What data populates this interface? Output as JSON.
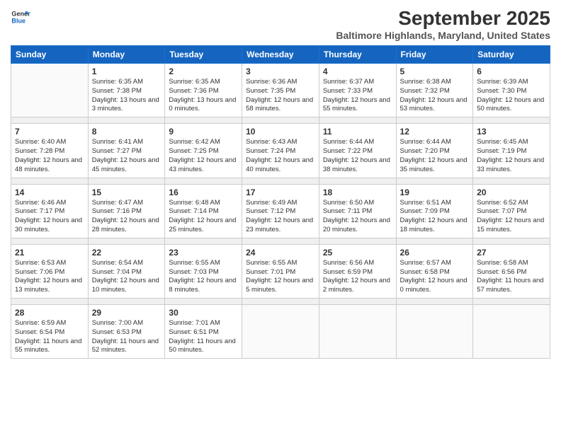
{
  "header": {
    "logo_line1": "General",
    "logo_line2": "Blue",
    "title": "September 2025",
    "subtitle": "Baltimore Highlands, Maryland, United States"
  },
  "days_of_week": [
    "Sunday",
    "Monday",
    "Tuesday",
    "Wednesday",
    "Thursday",
    "Friday",
    "Saturday"
  ],
  "weeks": [
    [
      {
        "day": "",
        "sunrise": "",
        "sunset": "",
        "daylight": ""
      },
      {
        "day": "1",
        "sunrise": "Sunrise: 6:35 AM",
        "sunset": "Sunset: 7:38 PM",
        "daylight": "Daylight: 13 hours and 3 minutes."
      },
      {
        "day": "2",
        "sunrise": "Sunrise: 6:35 AM",
        "sunset": "Sunset: 7:36 PM",
        "daylight": "Daylight: 13 hours and 0 minutes."
      },
      {
        "day": "3",
        "sunrise": "Sunrise: 6:36 AM",
        "sunset": "Sunset: 7:35 PM",
        "daylight": "Daylight: 12 hours and 58 minutes."
      },
      {
        "day": "4",
        "sunrise": "Sunrise: 6:37 AM",
        "sunset": "Sunset: 7:33 PM",
        "daylight": "Daylight: 12 hours and 55 minutes."
      },
      {
        "day": "5",
        "sunrise": "Sunrise: 6:38 AM",
        "sunset": "Sunset: 7:32 PM",
        "daylight": "Daylight: 12 hours and 53 minutes."
      },
      {
        "day": "6",
        "sunrise": "Sunrise: 6:39 AM",
        "sunset": "Sunset: 7:30 PM",
        "daylight": "Daylight: 12 hours and 50 minutes."
      }
    ],
    [
      {
        "day": "7",
        "sunrise": "Sunrise: 6:40 AM",
        "sunset": "Sunset: 7:28 PM",
        "daylight": "Daylight: 12 hours and 48 minutes."
      },
      {
        "day": "8",
        "sunrise": "Sunrise: 6:41 AM",
        "sunset": "Sunset: 7:27 PM",
        "daylight": "Daylight: 12 hours and 45 minutes."
      },
      {
        "day": "9",
        "sunrise": "Sunrise: 6:42 AM",
        "sunset": "Sunset: 7:25 PM",
        "daylight": "Daylight: 12 hours and 43 minutes."
      },
      {
        "day": "10",
        "sunrise": "Sunrise: 6:43 AM",
        "sunset": "Sunset: 7:24 PM",
        "daylight": "Daylight: 12 hours and 40 minutes."
      },
      {
        "day": "11",
        "sunrise": "Sunrise: 6:44 AM",
        "sunset": "Sunset: 7:22 PM",
        "daylight": "Daylight: 12 hours and 38 minutes."
      },
      {
        "day": "12",
        "sunrise": "Sunrise: 6:44 AM",
        "sunset": "Sunset: 7:20 PM",
        "daylight": "Daylight: 12 hours and 35 minutes."
      },
      {
        "day": "13",
        "sunrise": "Sunrise: 6:45 AM",
        "sunset": "Sunset: 7:19 PM",
        "daylight": "Daylight: 12 hours and 33 minutes."
      }
    ],
    [
      {
        "day": "14",
        "sunrise": "Sunrise: 6:46 AM",
        "sunset": "Sunset: 7:17 PM",
        "daylight": "Daylight: 12 hours and 30 minutes."
      },
      {
        "day": "15",
        "sunrise": "Sunrise: 6:47 AM",
        "sunset": "Sunset: 7:16 PM",
        "daylight": "Daylight: 12 hours and 28 minutes."
      },
      {
        "day": "16",
        "sunrise": "Sunrise: 6:48 AM",
        "sunset": "Sunset: 7:14 PM",
        "daylight": "Daylight: 12 hours and 25 minutes."
      },
      {
        "day": "17",
        "sunrise": "Sunrise: 6:49 AM",
        "sunset": "Sunset: 7:12 PM",
        "daylight": "Daylight: 12 hours and 23 minutes."
      },
      {
        "day": "18",
        "sunrise": "Sunrise: 6:50 AM",
        "sunset": "Sunset: 7:11 PM",
        "daylight": "Daylight: 12 hours and 20 minutes."
      },
      {
        "day": "19",
        "sunrise": "Sunrise: 6:51 AM",
        "sunset": "Sunset: 7:09 PM",
        "daylight": "Daylight: 12 hours and 18 minutes."
      },
      {
        "day": "20",
        "sunrise": "Sunrise: 6:52 AM",
        "sunset": "Sunset: 7:07 PM",
        "daylight": "Daylight: 12 hours and 15 minutes."
      }
    ],
    [
      {
        "day": "21",
        "sunrise": "Sunrise: 6:53 AM",
        "sunset": "Sunset: 7:06 PM",
        "daylight": "Daylight: 12 hours and 13 minutes."
      },
      {
        "day": "22",
        "sunrise": "Sunrise: 6:54 AM",
        "sunset": "Sunset: 7:04 PM",
        "daylight": "Daylight: 12 hours and 10 minutes."
      },
      {
        "day": "23",
        "sunrise": "Sunrise: 6:55 AM",
        "sunset": "Sunset: 7:03 PM",
        "daylight": "Daylight: 12 hours and 8 minutes."
      },
      {
        "day": "24",
        "sunrise": "Sunrise: 6:55 AM",
        "sunset": "Sunset: 7:01 PM",
        "daylight": "Daylight: 12 hours and 5 minutes."
      },
      {
        "day": "25",
        "sunrise": "Sunrise: 6:56 AM",
        "sunset": "Sunset: 6:59 PM",
        "daylight": "Daylight: 12 hours and 2 minutes."
      },
      {
        "day": "26",
        "sunrise": "Sunrise: 6:57 AM",
        "sunset": "Sunset: 6:58 PM",
        "daylight": "Daylight: 12 hours and 0 minutes."
      },
      {
        "day": "27",
        "sunrise": "Sunrise: 6:58 AM",
        "sunset": "Sunset: 6:56 PM",
        "daylight": "Daylight: 11 hours and 57 minutes."
      }
    ],
    [
      {
        "day": "28",
        "sunrise": "Sunrise: 6:59 AM",
        "sunset": "Sunset: 6:54 PM",
        "daylight": "Daylight: 11 hours and 55 minutes."
      },
      {
        "day": "29",
        "sunrise": "Sunrise: 7:00 AM",
        "sunset": "Sunset: 6:53 PM",
        "daylight": "Daylight: 11 hours and 52 minutes."
      },
      {
        "day": "30",
        "sunrise": "Sunrise: 7:01 AM",
        "sunset": "Sunset: 6:51 PM",
        "daylight": "Daylight: 11 hours and 50 minutes."
      },
      {
        "day": "",
        "sunrise": "",
        "sunset": "",
        "daylight": ""
      },
      {
        "day": "",
        "sunrise": "",
        "sunset": "",
        "daylight": ""
      },
      {
        "day": "",
        "sunrise": "",
        "sunset": "",
        "daylight": ""
      },
      {
        "day": "",
        "sunrise": "",
        "sunset": "",
        "daylight": ""
      }
    ]
  ]
}
